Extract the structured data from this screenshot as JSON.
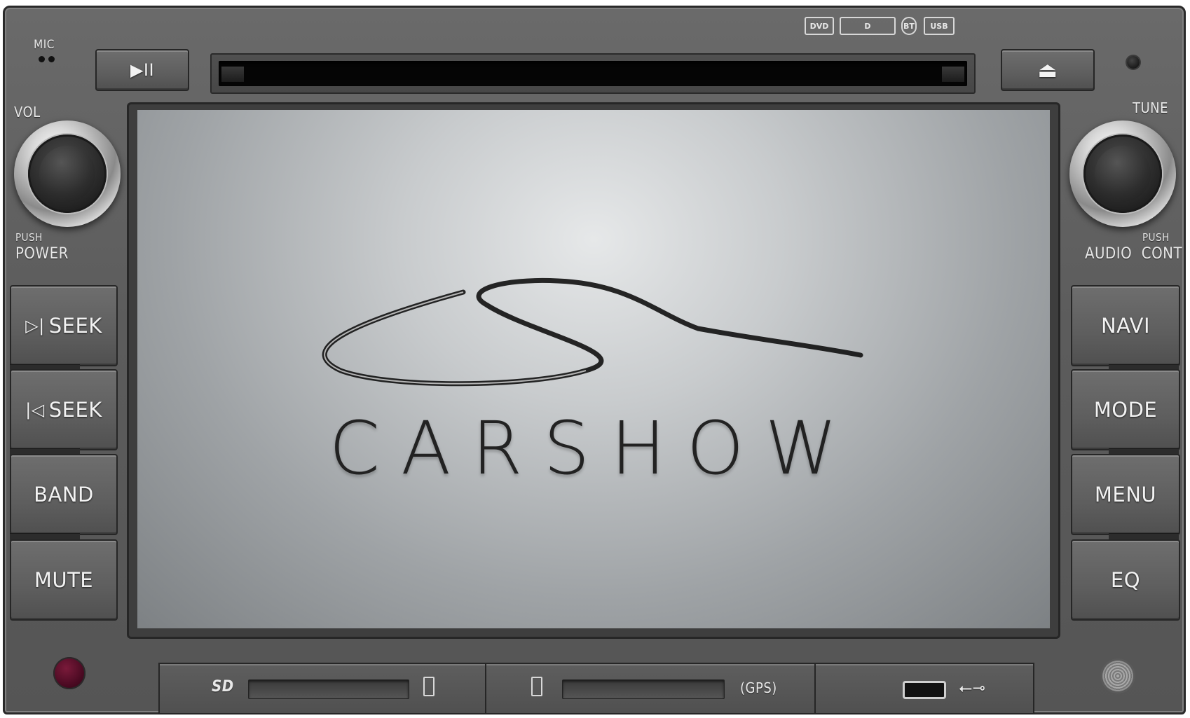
{
  "labels": {
    "mic": "MIC",
    "vol": "VOL",
    "push_left": "PUSH",
    "power": "POWER",
    "tune": "TUNE",
    "push_right": "PUSH",
    "audio_cont": "AUDIO  CONT",
    "gps": "(GPS)"
  },
  "top_buttons": {
    "play_pause": "▶II",
    "eject": "⏏"
  },
  "left_buttons": [
    {
      "icon": "▷|",
      "label": "SEEK"
    },
    {
      "icon": "|◁",
      "label": "SEEK"
    },
    {
      "label": "BAND"
    },
    {
      "label": "MUTE"
    }
  ],
  "right_buttons": [
    {
      "label": "NAVI"
    },
    {
      "label": "MODE"
    },
    {
      "label": "MENU"
    },
    {
      "label": "EQ"
    }
  ],
  "media_logos": [
    "DVD",
    "D",
    "BT",
    "USB"
  ],
  "screen": {
    "brand": "CARSHOW"
  },
  "ports": {
    "sd_label": "SD",
    "usb_symbol": "⭠⊸"
  },
  "colors": {
    "housing": "#5c5c5c",
    "button_text": "#f2f2f2",
    "screen_center": "#e6e8e9",
    "reset_button": "#4a0a22"
  }
}
